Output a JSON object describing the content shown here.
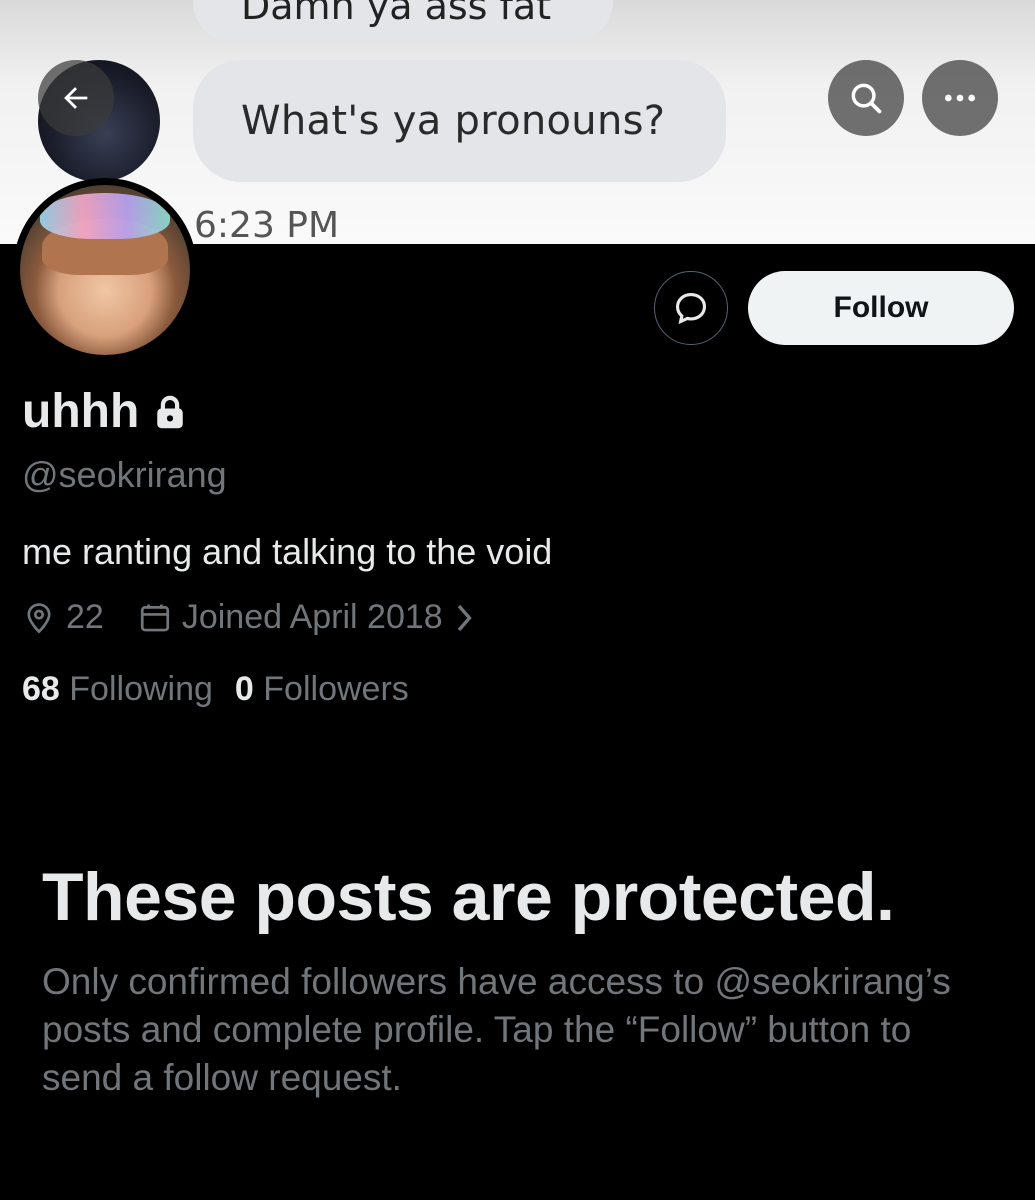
{
  "banner": {
    "bubble_partial_text": "Damn ya ass fat",
    "bubble_text": "What's ya pronouns?",
    "timestamp": "6:23 PM"
  },
  "header": {
    "back_icon": "back-arrow-icon",
    "search_icon": "search-icon",
    "more_icon": "more-icon"
  },
  "profile": {
    "display_name": "uhhh",
    "handle": "@seokrirang",
    "bio": "me ranting and talking to the void",
    "location": "22",
    "joined": "Joined April 2018",
    "following_count": "68",
    "following_label": "Following",
    "followers_count": "0",
    "followers_label": "Followers",
    "locked": true
  },
  "actions": {
    "follow_label": "Follow",
    "message_icon": "message-icon"
  },
  "protected": {
    "title": "These posts are protected.",
    "description": "Only confirmed followers have access to @seokrirang’s posts and complete profile. Tap the “Follow” button to send a follow request."
  },
  "colors": {
    "background": "#000000",
    "primary_text": "#e7e9ea",
    "secondary_text": "#71767b",
    "follow_button_bg": "#eff3f4"
  }
}
